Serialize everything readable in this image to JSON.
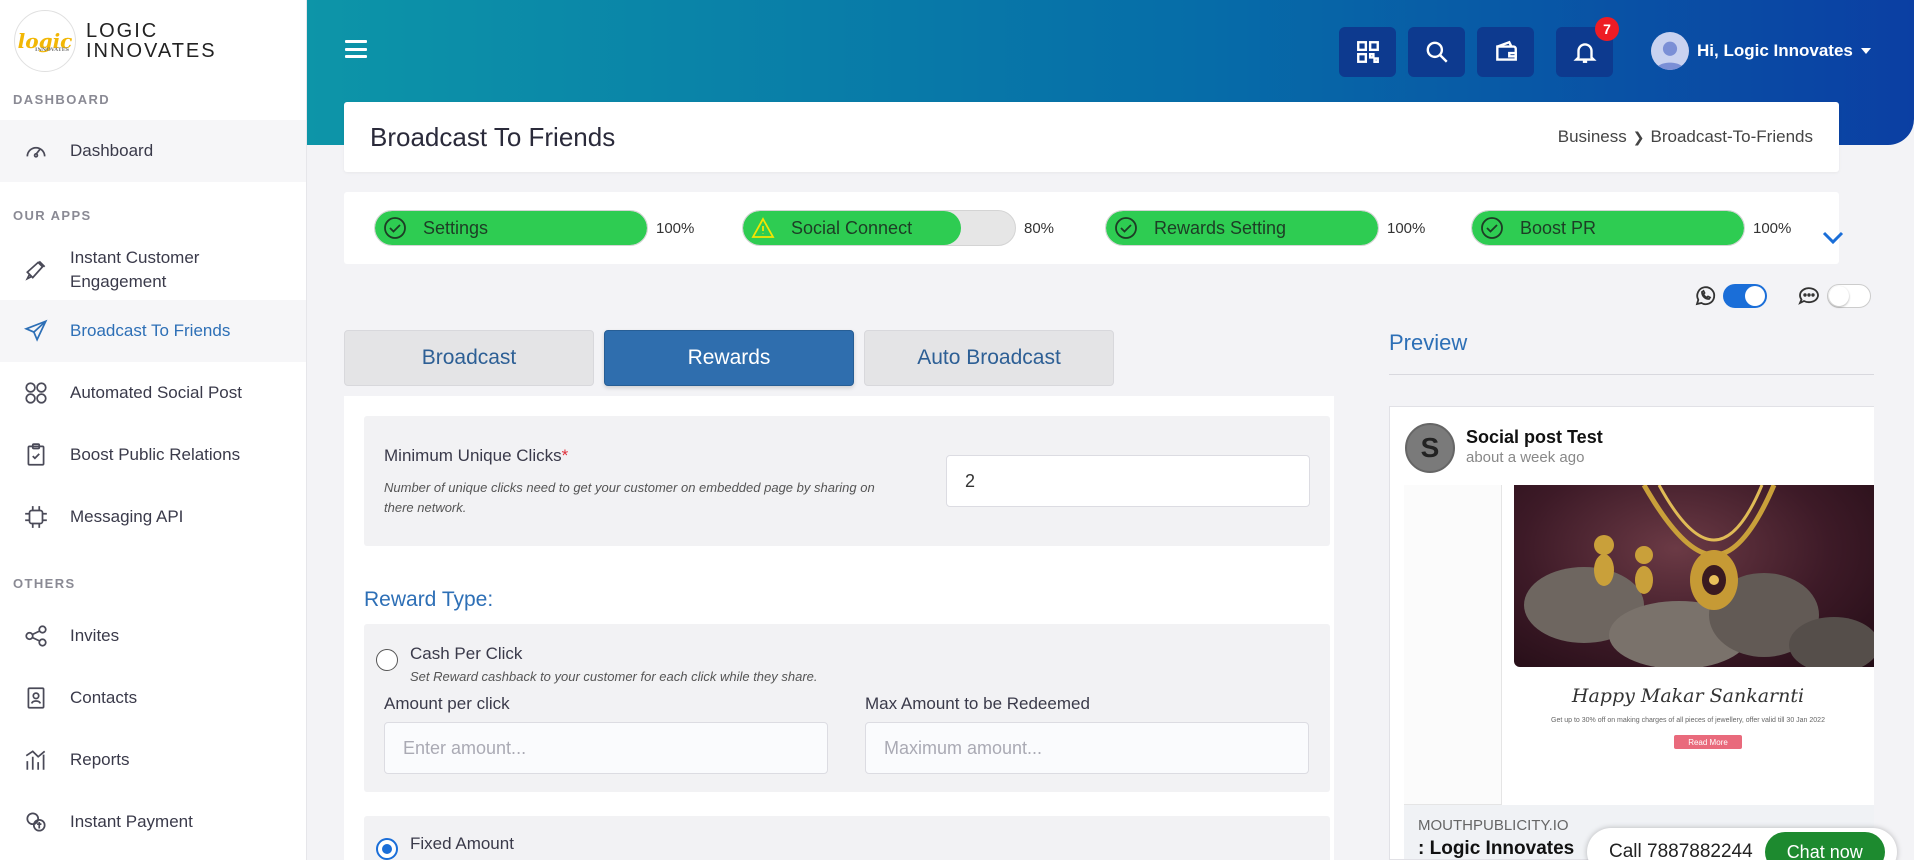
{
  "brand": {
    "logo_text": "logic",
    "logo_sub": "INNOVATES",
    "name_line1": "LOGIC",
    "name_line2": "INNOVATES"
  },
  "sidebar": {
    "sections": {
      "dashboard": "DASHBOARD",
      "apps": "OUR APPS",
      "others": "OTHERS"
    },
    "items": [
      {
        "label": "Dashboard",
        "icon": "speedometer-icon"
      },
      {
        "label": "Instant Customer Engagement",
        "icon": "megaphone-icon"
      },
      {
        "label": "Broadcast To Friends",
        "icon": "paper-plane-icon"
      },
      {
        "label": "Automated Social Post",
        "icon": "social-grid-icon"
      },
      {
        "label": "Boost Public Relations",
        "icon": "clipboard-icon"
      },
      {
        "label": "Messaging API",
        "icon": "api-chip-icon"
      },
      {
        "label": "Invites",
        "icon": "share-nodes-icon"
      },
      {
        "label": "Contacts",
        "icon": "contact-book-icon"
      },
      {
        "label": "Reports",
        "icon": "bar-chart-icon"
      },
      {
        "label": "Instant Payment",
        "icon": "payment-icon"
      }
    ]
  },
  "header": {
    "notifications_count": "7",
    "user_greeting": "Hi, Logic Innovates",
    "icons": [
      "qr-code-icon",
      "search-icon",
      "wallet-icon",
      "bell-icon"
    ]
  },
  "page": {
    "title": "Broadcast To Friends",
    "breadcrumb": {
      "parent": "Business",
      "current": "Broadcast-To-Friends"
    }
  },
  "progress": [
    {
      "label": "Settings",
      "percent_text": "100%",
      "value": 100,
      "status": "done"
    },
    {
      "label": "Social Connect",
      "percent_text": "80%",
      "value": 80,
      "status": "warning"
    },
    {
      "label": "Rewards Setting",
      "percent_text": "100%",
      "value": 100,
      "status": "done"
    },
    {
      "label": "Boost PR",
      "percent_text": "100%",
      "value": 100,
      "status": "done"
    }
  ],
  "toggles": {
    "whatsapp_on": true,
    "sms_on": false
  },
  "tabs": [
    {
      "label": "Broadcast",
      "active": false
    },
    {
      "label": "Rewards",
      "active": true
    },
    {
      "label": "Auto Broadcast",
      "active": false
    }
  ],
  "form": {
    "min_clicks": {
      "label": "Minimum Unique Clicks",
      "required_mark": "*",
      "help": "Number of unique clicks need to get your customer on embedded page by sharing on there network.",
      "value": "2"
    },
    "reward_type_heading": "Reward Type:",
    "cash_per_click": {
      "label": "Cash Per Click",
      "help": "Set Reward cashback to your customer for each click while they share.",
      "selected": false,
      "amount_label": "Amount per click",
      "amount_placeholder": "Enter amount...",
      "max_label": "Max Amount to be Redeemed",
      "max_placeholder": "Maximum amount..."
    },
    "fixed_amount": {
      "label": "Fixed Amount",
      "selected": true
    }
  },
  "preview": {
    "heading": "Preview",
    "avatar_letter": "S",
    "post_name": "Social post Test",
    "post_time": "about a week ago",
    "image_title": "Happy Makar Sankarnti",
    "image_subtitle": "Get up to 30% off on making charges of all pieces of jewellery, offer valid till 30 Jan 2022",
    "image_button": "Read More",
    "domain": "MOUTHPUBLICITY.IO",
    "site_name": ": Logic Innovates"
  },
  "chat": {
    "phone": "Call 7887882244",
    "button": "Chat now"
  },
  "colors": {
    "accent": "#2d6fb6",
    "progress_green": "#2ecc52",
    "header_start": "#0d95a8",
    "header_end": "#0b3fa3",
    "badge_red": "#ee1c24",
    "chat_green": "#1d8a2f"
  }
}
